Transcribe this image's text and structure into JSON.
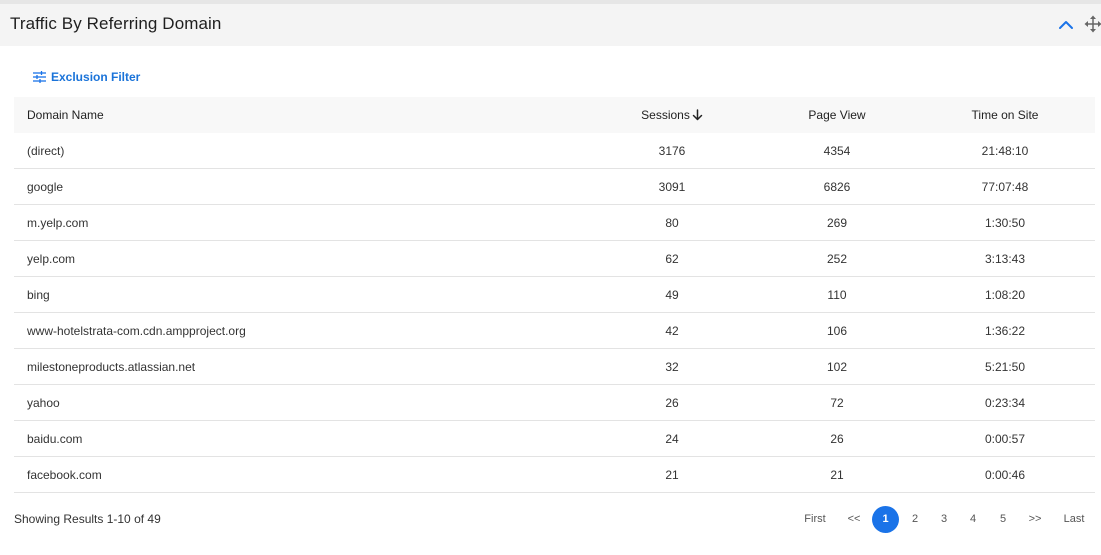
{
  "widget": {
    "title": "Traffic By Referring Domain"
  },
  "filter": {
    "label": "Exclusion Filter"
  },
  "table": {
    "headers": {
      "domain": "Domain Name",
      "sessions": "Sessions",
      "page_view": "Page View",
      "time_on_site": "Time on Site"
    },
    "sort": {
      "column": "sessions",
      "direction": "descending"
    },
    "rows": [
      {
        "domain": "(direct)",
        "sessions": "3176",
        "page_view": "4354",
        "time": "21:48:10"
      },
      {
        "domain": "google",
        "sessions": "3091",
        "page_view": "6826",
        "time": "77:07:48"
      },
      {
        "domain": "m.yelp.com",
        "sessions": "80",
        "page_view": "269",
        "time": "1:30:50"
      },
      {
        "domain": "yelp.com",
        "sessions": "62",
        "page_view": "252",
        "time": "3:13:43"
      },
      {
        "domain": "bing",
        "sessions": "49",
        "page_view": "110",
        "time": "1:08:20"
      },
      {
        "domain": "www-hotelstrata-com.cdn.ampproject.org",
        "sessions": "42",
        "page_view": "106",
        "time": "1:36:22"
      },
      {
        "domain": "milestoneproducts.atlassian.net",
        "sessions": "32",
        "page_view": "102",
        "time": "5:21:50"
      },
      {
        "domain": "yahoo",
        "sessions": "26",
        "page_view": "72",
        "time": "0:23:34"
      },
      {
        "domain": "baidu.com",
        "sessions": "24",
        "page_view": "26",
        "time": "0:00:57"
      },
      {
        "domain": "facebook.com",
        "sessions": "21",
        "page_view": "21",
        "time": "0:00:46"
      }
    ]
  },
  "footer": {
    "summary": "Showing Results 1-10 of 49"
  },
  "pagination": {
    "first": "First",
    "prev": "<<",
    "pages": [
      "1",
      "2",
      "3",
      "4",
      "5"
    ],
    "current": "1",
    "next": ">>",
    "last": "Last"
  },
  "colors": {
    "accent": "#1a73e8",
    "header_bg": "#f4f4f4"
  },
  "icons": {
    "collapse": "chevron-up-icon",
    "move": "move-arrows-icon",
    "filter": "sliders-icon",
    "sort": "arrow-down-icon"
  }
}
